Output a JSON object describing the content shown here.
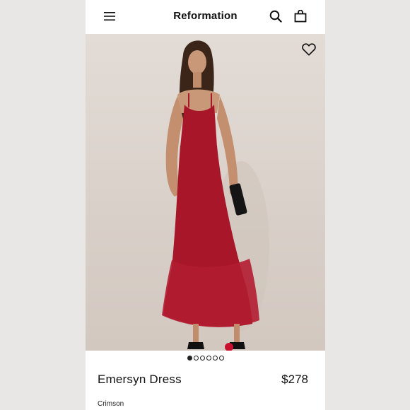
{
  "header": {
    "brand": "Reformation",
    "icons": [
      "menu-icon",
      "search-icon",
      "bag-icon"
    ]
  },
  "hero": {
    "favorite_icon": "heart-icon",
    "image_subject": "model wearing crimson dress"
  },
  "carousel": {
    "total": 6,
    "active_index": 0
  },
  "product": {
    "name": "Emersyn Dress",
    "price": "$278",
    "color": "Crimson"
  },
  "colors": {
    "background": "#e9e7e5",
    "dress": "#a8162a",
    "text": "#111111"
  }
}
